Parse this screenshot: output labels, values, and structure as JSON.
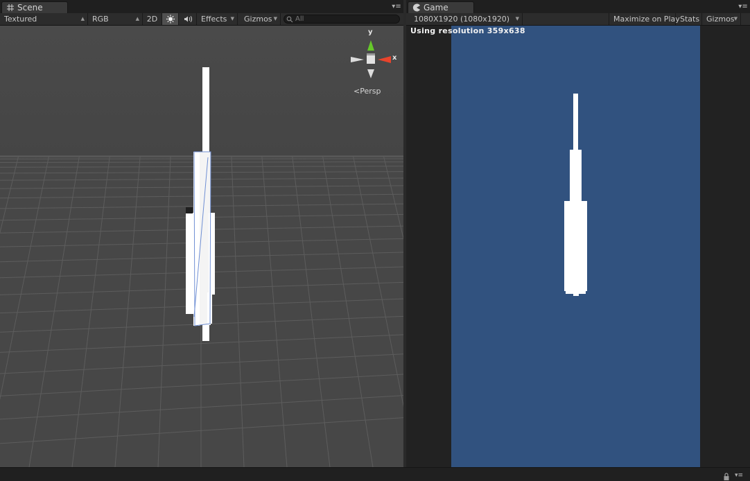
{
  "scene": {
    "tab_title": "Scene",
    "toolbar": {
      "draw_mode": "Textured",
      "render_mode": "RGB",
      "mode_2d": "2D",
      "effects": "Effects",
      "gizmos": "Gizmos",
      "search_placeholder": "All"
    },
    "gizmo": {
      "y_label": "y",
      "x_label": "x",
      "projection": "Persp"
    }
  },
  "game": {
    "tab_title": "Game",
    "toolbar": {
      "resolution": "1080X1920 (1080x1920)",
      "maximize_on_play": "Maximize on Play",
      "stats": "Stats",
      "gizmos": "Gizmos"
    },
    "resolution_notice": "Using resolution 359x638",
    "background_color": "#31527f"
  },
  "colors": {
    "panel_bg": "#2e2e2e",
    "grid_bg": "#454545",
    "selection_outline": "#6f8fd4"
  }
}
